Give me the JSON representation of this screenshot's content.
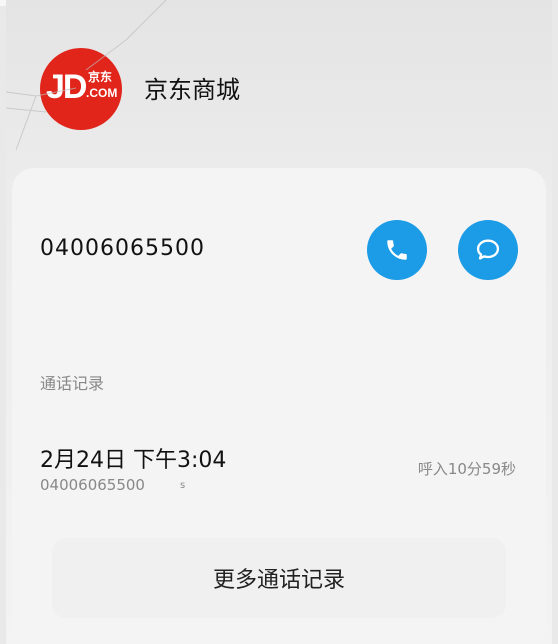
{
  "contact": {
    "logo_text": "JD",
    "logo_cn": "京东",
    "logo_com": ".COM",
    "name": "京东商城",
    "phone": "04006065500"
  },
  "actions": {
    "call_icon": "phone-icon",
    "message_icon": "message-icon",
    "accent_color": "#1c9be6"
  },
  "history": {
    "section_label": "通话记录",
    "records": [
      {
        "datetime": "2月24日 下午3:04",
        "number": "04006065500",
        "sim": "s",
        "duration": "呼入10分59秒"
      }
    ],
    "more_label": "更多通话记录"
  }
}
